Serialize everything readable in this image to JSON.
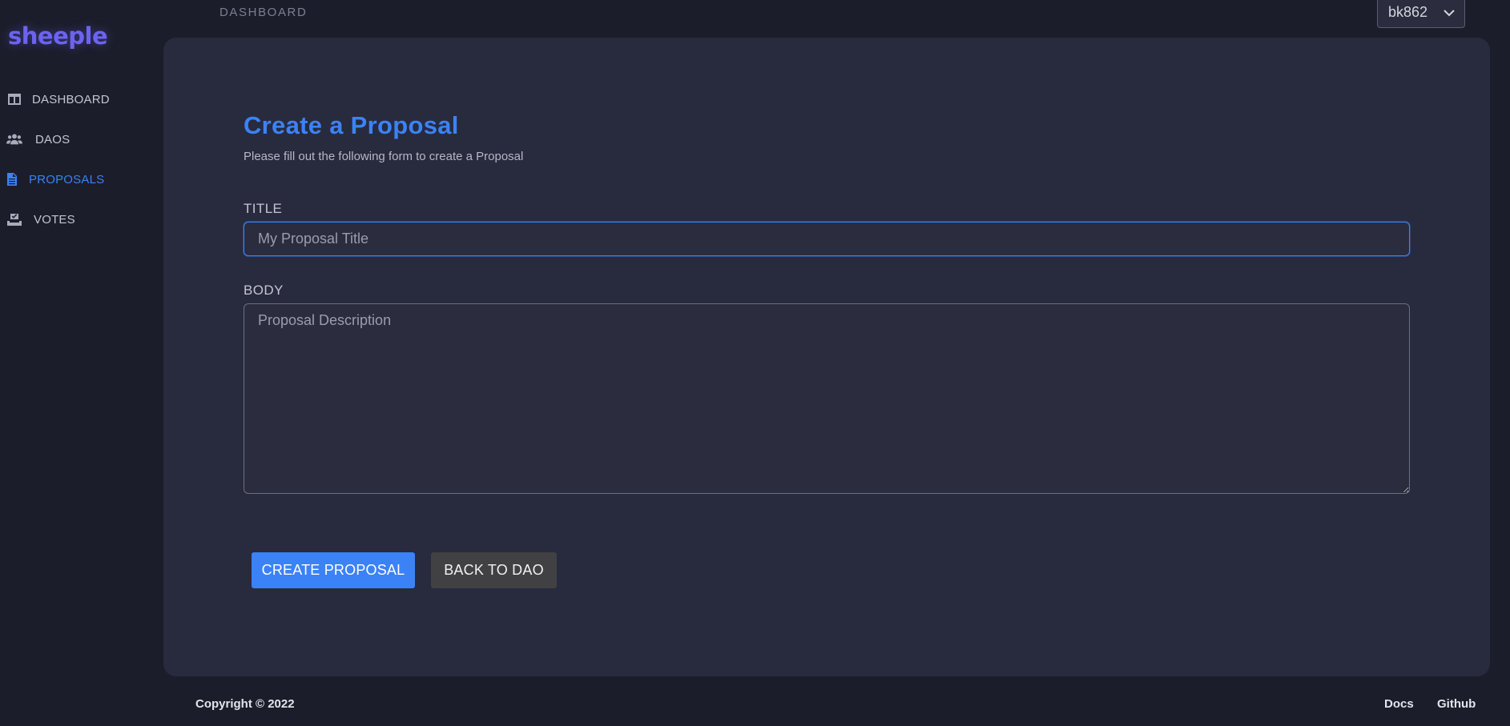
{
  "app": {
    "logo": "sheeple"
  },
  "sidebar": {
    "items": [
      {
        "label": "DASHBOARD",
        "icon": "layout-columns-icon",
        "active": false
      },
      {
        "label": "DAOS",
        "icon": "users-icon",
        "active": false
      },
      {
        "label": "PROPOSALS",
        "icon": "document-icon",
        "active": true
      },
      {
        "label": "VOTES",
        "icon": "vote-box-icon",
        "active": false
      }
    ]
  },
  "header": {
    "breadcrumb": "DASHBOARD",
    "user": "bk862"
  },
  "form": {
    "title": "Create a Proposal",
    "subtitle": "Please fill out the following form to create a Proposal",
    "title_label": "TITLE",
    "title_value": "",
    "title_placeholder": "My Proposal Title",
    "body_label": "BODY",
    "body_value": "",
    "body_placeholder": "Proposal Description",
    "create_button": "CREATE PROPOSAL",
    "back_button": "BACK TO DAO"
  },
  "footer": {
    "copyright": "Copyright © 2022",
    "docs": "Docs",
    "github": "Github"
  },
  "colors": {
    "background": "#1c1d2b",
    "card": "#282a3e",
    "accent": "#3b82f6",
    "logo": "#6c63f0",
    "secondary_button": "#414143"
  }
}
